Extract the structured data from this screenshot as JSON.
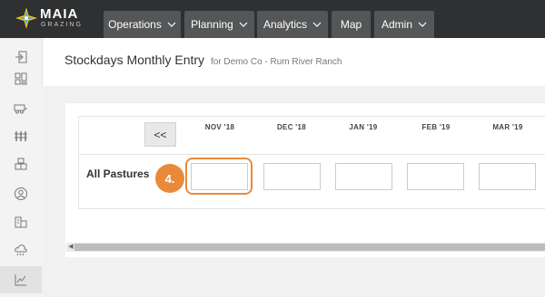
{
  "brand": {
    "name": "MAIA",
    "tagline": "GRAZING"
  },
  "nav": {
    "tabs": [
      {
        "label": "Operations",
        "has_dropdown": true
      },
      {
        "label": "Planning",
        "has_dropdown": true
      },
      {
        "label": "Analytics",
        "has_dropdown": true
      },
      {
        "label": "Map",
        "has_dropdown": false
      },
      {
        "label": "Admin",
        "has_dropdown": true
      }
    ]
  },
  "sidebar": {
    "icons": [
      "login-icon",
      "dashboard-icon",
      "livestock-trailer-icon",
      "fence-icon",
      "boxes-icon",
      "user-icon",
      "buildings-icon",
      "weather-icon",
      "chart-icon"
    ],
    "active": "chart-icon"
  },
  "page": {
    "title": "Stockdays Monthly Entry",
    "subtitle": "for Demo Co - Rum River Ranch"
  },
  "grid": {
    "prev_label": "<<",
    "months": [
      "NOV '18",
      "DEC '18",
      "JAN '19",
      "FEB '19",
      "MAR '19"
    ],
    "row_label": "All Pastures",
    "values": [
      "",
      "",
      "",
      "",
      ""
    ]
  },
  "annotation": {
    "step": "4."
  },
  "colors": {
    "nav_bg": "#2f3031",
    "tab_bg": "#555657",
    "highlight": "#e98a3b"
  }
}
